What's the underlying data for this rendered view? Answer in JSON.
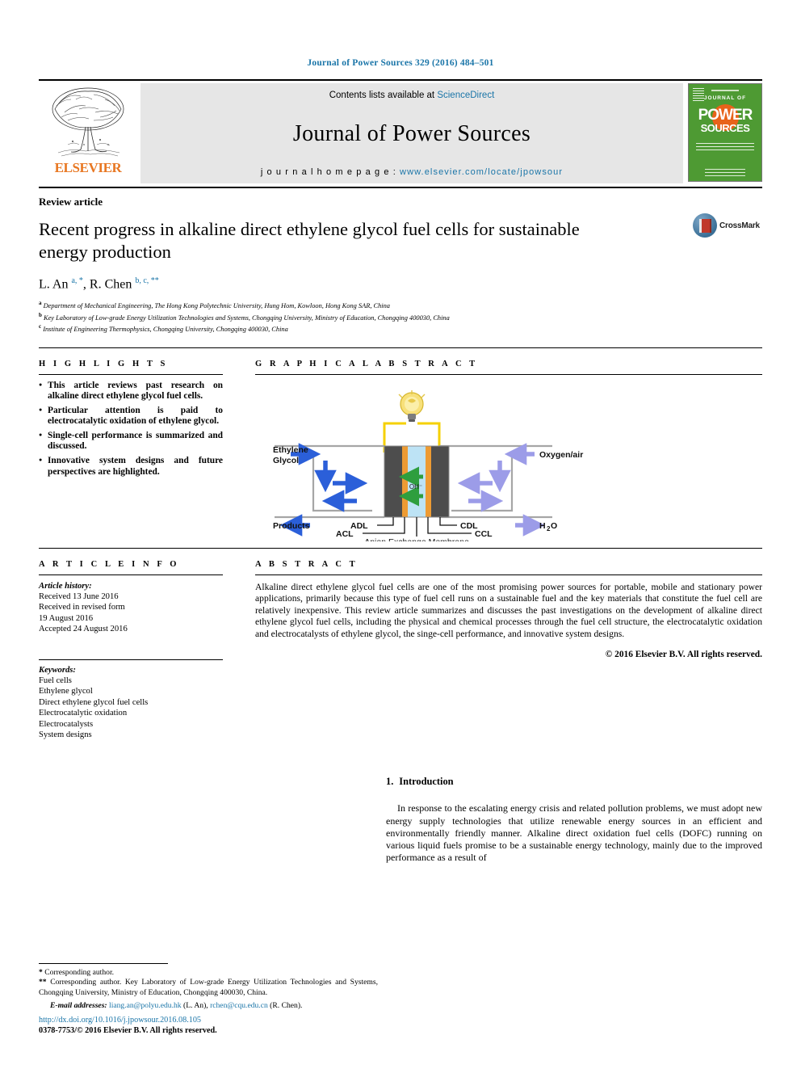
{
  "running_head": "Journal of Power Sources 329 (2016) 484–501",
  "masthead": {
    "contents_prefix": "Contents lists available at ",
    "sciencedirect": "ScienceDirect",
    "journal_name": "Journal of Power Sources",
    "homepage_label": "j o u r n a l   h o m e p a g e :  ",
    "homepage_url": "www.elsevier.com/locate/jpowsour",
    "publisher": "ELSEVIER",
    "cover": {
      "line1": "JOURNAL OF",
      "line2": "POWER",
      "line3": "SOURCES"
    }
  },
  "article": {
    "type_label": "Review article",
    "title": "Recent progress in alkaline direct ethylene glycol fuel cells for sustainable energy production",
    "authors_html": "L. An <sup>a, *</sup>, R. Chen <sup>b, c, **</sup>",
    "affiliations": [
      {
        "mark": "a",
        "text": "Department of Mechanical Engineering, The Hong Kong Polytechnic University, Hung Hom, Kowloon, Hong Kong SAR, China"
      },
      {
        "mark": "b",
        "text": "Key Laboratory of Low-grade Energy Utilization Technologies and Systems, Chongqing University, Ministry of Education, Chongqing 400030, China"
      },
      {
        "mark": "c",
        "text": "Institute of Engineering Thermophysics, Chongqing University, Chongqing 400030, China"
      }
    ],
    "crossmark_label": "CrossMark"
  },
  "highlights": {
    "heading": "H I G H L I G H T S",
    "items": [
      "This article reviews past research on alkaline direct ethylene glycol fuel cells.",
      "Particular attention is paid to electrocatalytic oxidation of ethylene glycol.",
      "Single-cell performance is summarized and discussed.",
      "Innovative system designs and future perspectives are highlighted."
    ]
  },
  "graphical_abstract": {
    "heading": "G R A P H I C A L   A B S T R A C T",
    "labels": {
      "fuel_in_line1": "Ethylene",
      "fuel_in_line2": "Glycol",
      "oxidant_in": "Oxygen/air",
      "products_out": "Products",
      "water_out": "H₂O",
      "ion": "OH⁻",
      "adl": "ADL",
      "acl": "ACL",
      "cdl": "CDL",
      "ccl": "CCL",
      "membrane": "Anion Exchange Membrane"
    },
    "colors": {
      "diffusion_layer": "#4d4d4d",
      "catalyst_layer": "#ed9b33",
      "membrane": "#bde3f5",
      "anode_arrow": "#2b5fd9",
      "cathode_arrow": "#9c9ce8",
      "ion_arrow": "#2e9e3e",
      "circuit": "#f5d000",
      "bulb": "#f5d34a"
    }
  },
  "article_info": {
    "heading": "A R T I C L E   I N F O",
    "history_label": "Article history:",
    "history": [
      "Received 13 June 2016",
      "Received in revised form",
      "19 August 2016",
      "Accepted 24 August 2016"
    ],
    "keywords_label": "Keywords:",
    "keywords": [
      "Fuel cells",
      "Ethylene glycol",
      "Direct ethylene glycol fuel cells",
      "Electrocatalytic oxidation",
      "Electrocatalysts",
      "System designs"
    ]
  },
  "abstract": {
    "heading": "A B S T R A C T",
    "text": "Alkaline direct ethylene glycol fuel cells are one of the most promising power sources for portable, mobile and stationary power applications, primarily because this type of fuel cell runs on a sustainable fuel and the key materials that constitute the fuel cell are relatively inexpensive. This review article summarizes and discusses the past investigations on the development of alkaline direct ethylene glycol fuel cells, including the physical and chemical processes through the fuel cell structure, the electrocatalytic oxidation and electrocatalysts of ethylene glycol, the singe-cell performance, and innovative system designs.",
    "copyright": "© 2016 Elsevier B.V. All rights reserved."
  },
  "introduction": {
    "number": "1.",
    "heading": "Introduction",
    "paragraph": "In response to the escalating energy crisis and related pollution problems, we must adopt new energy supply technologies that utilize renewable energy sources in an efficient and environmentally friendly manner. Alkaline direct oxidation fuel cells (DOFC) running on various liquid fuels promise to be a sustainable energy technology, mainly due to the improved performance as a result of"
  },
  "footnotes": {
    "corresponding_1_mark": "*",
    "corresponding_1": "Corresponding author.",
    "corresponding_2_mark": "**",
    "corresponding_2": "Corresponding author. Key Laboratory of Low-grade Energy Utilization Technologies and Systems, Chongqing University, Ministry of Education, Chongqing 400030, China.",
    "email_label": "E-mail addresses:",
    "email_1": "liang.an@polyu.edu.hk",
    "email_1_who": "(L. An),",
    "email_2": "rchen@cqu.edu.cn",
    "email_2_who": "(R. Chen).",
    "doi": "http://dx.doi.org/10.1016/j.jpowsour.2016.08.105",
    "issn": "0378-7753/© 2016 Elsevier B.V. All rights reserved."
  }
}
